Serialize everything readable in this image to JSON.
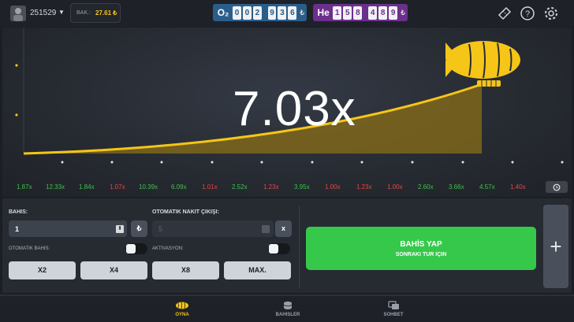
{
  "header": {
    "user_id": "251529",
    "balance_label": "BAK.:",
    "balance_value": "27.61 ₺",
    "o2": {
      "gas": "O₂",
      "digits": [
        "0",
        "0",
        "2",
        "9",
        "3",
        "6"
      ],
      "currency": "₺"
    },
    "he": {
      "gas": "He",
      "digits": [
        "1",
        "5",
        "8",
        "4",
        "8",
        "9"
      ],
      "currency": "₺"
    },
    "icons": [
      "ticket-icon",
      "help-icon",
      "settings-icon"
    ]
  },
  "game": {
    "multiplier": "7.03x",
    "accent_color": "#f5c518"
  },
  "history": [
    {
      "value": "1.87x",
      "color": "#3ec24a"
    },
    {
      "value": "12.33x",
      "color": "#3ec24a"
    },
    {
      "value": "1.84x",
      "color": "#3ec24a"
    },
    {
      "value": "1.07x",
      "color": "#e04848"
    },
    {
      "value": "10.39x",
      "color": "#3ec24a"
    },
    {
      "value": "6.09x",
      "color": "#3ec24a"
    },
    {
      "value": "1.01x",
      "color": "#e04848"
    },
    {
      "value": "2.52x",
      "color": "#3ec24a"
    },
    {
      "value": "1.23x",
      "color": "#e04848"
    },
    {
      "value": "3.95x",
      "color": "#3ec24a"
    },
    {
      "value": "1.00x",
      "color": "#e04848"
    },
    {
      "value": "1.23x",
      "color": "#e04848"
    },
    {
      "value": "1.00x",
      "color": "#e04848"
    },
    {
      "value": "2.60x",
      "color": "#3ec24a"
    },
    {
      "value": "3.66x",
      "color": "#3ec24a"
    },
    {
      "value": "4.57x",
      "color": "#3ec24a"
    },
    {
      "value": "1.40x",
      "color": "#e04848"
    }
  ],
  "controls": {
    "bet_label": "BAHIS:",
    "bet_value": "1",
    "bet_currency": "₺",
    "auto_cashout_label": "OTOMATIK NAKIT ÇIKIŞI:",
    "auto_cashout_value": "5",
    "clear_label": "x",
    "auto_bet_label": "OTOMATIK BAHIS:",
    "activation_label": "AKTIVASYON:",
    "quick": [
      "X2",
      "X4",
      "X8",
      "MAX."
    ],
    "bet_button": "BAHİS YAP",
    "bet_button_sub": "SONRAKI TUR IÇIN",
    "add_label": "+"
  },
  "nav": {
    "play": "OYNA",
    "bets": "BAHISLER",
    "chat": "SOHBET"
  }
}
